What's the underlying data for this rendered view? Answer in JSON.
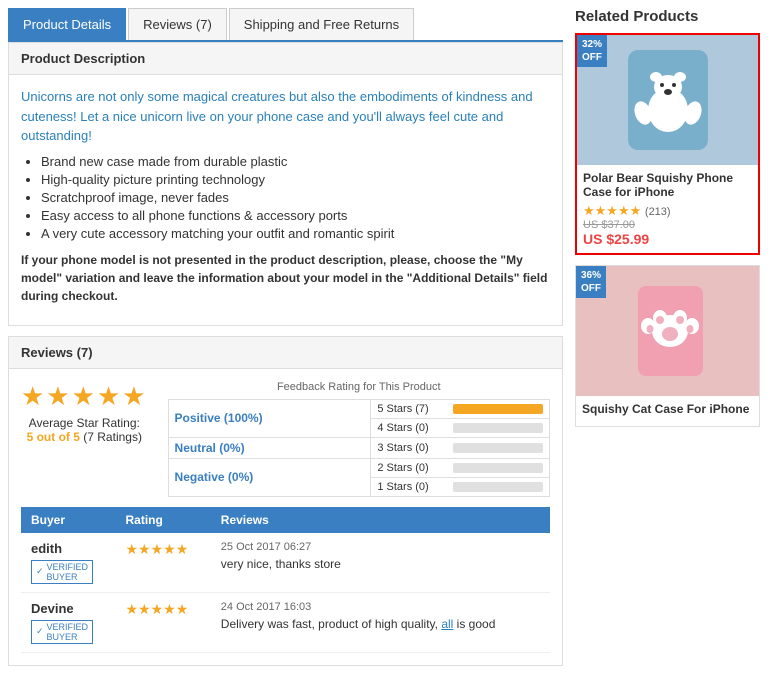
{
  "tabs": [
    {
      "label": "Product Details",
      "active": true
    },
    {
      "label": "Reviews (7)",
      "active": false
    },
    {
      "label": "Shipping and Free Returns",
      "active": false
    }
  ],
  "product_description": {
    "header": "Product Description",
    "intro": "Unicorns are not only some magical creatures but also the embodiments of kindness and cuteness! Let a nice unicorn live on your phone case and you'll always feel cute and outstanding!",
    "bullets": [
      "Brand new case made from durable plastic",
      "High-quality picture printing technology",
      "Scratchproof image, never fades",
      "Easy access to all phone functions & accessory ports",
      "A very cute accessory matching your outfit and romantic spirit"
    ],
    "notice": "If your phone model is not presented in the product description, please, choose the \"My model\" variation and leave the information about your model in the \"Additional Details\" field during checkout."
  },
  "reviews": {
    "header": "Reviews (7)",
    "avg_stars": "★★★★★",
    "avg_text": "Average Star Rating:",
    "avg_score": "5 out of 5",
    "avg_count": "(7 Ratings)",
    "feedback_title": "Feedback Rating for This Product",
    "feedback_rows": [
      {
        "label": "Positive (100%)",
        "stars": [
          {
            "label": "5 Stars (7)",
            "pct": 100
          },
          {
            "label": "4 Stars (0)",
            "pct": 0
          }
        ]
      },
      {
        "label": "Neutral (0%)",
        "stars": [
          {
            "label": "3 Stars (0)",
            "pct": 0
          }
        ]
      },
      {
        "label": "Negative (0%)",
        "stars": [
          {
            "label": "2 Stars (0)",
            "pct": 0
          },
          {
            "label": "1 Stars (0)",
            "pct": 0
          }
        ]
      }
    ],
    "bars": [
      {
        "label": "5 Stars (7)",
        "pct": 100
      },
      {
        "label": "4 Stars (0)",
        "pct": 0
      },
      {
        "label": "3 Stars (0)",
        "pct": 0
      },
      {
        "label": "2 Stars (0)",
        "pct": 0
      },
      {
        "label": "1 Stars (0)",
        "pct": 0
      }
    ],
    "table_headers": [
      "Buyer",
      "Rating",
      "Reviews"
    ],
    "entries": [
      {
        "buyer": "edith",
        "date": "25 Oct 2017 06:27",
        "stars": "★★★★★",
        "text": "very nice, thanks store",
        "verified": true
      },
      {
        "buyer": "Devine",
        "date": "24 Oct 2017 16:03",
        "stars": "★★★★★",
        "text": "Delivery was fast, product of high quality, all is good",
        "link_word": "all",
        "verified": true
      }
    ]
  },
  "sidebar": {
    "title": "Related Products",
    "products": [
      {
        "name": "Polar Bear Squishy Phone Case for iPhone",
        "discount": "32%\nOFF",
        "stars": "★★★★★",
        "review_count": "(213)",
        "price_old": "US $37.00",
        "price_new": "US $25.99",
        "highlighted": true,
        "img_type": "bear"
      },
      {
        "name": "Squishy Cat Case For iPhone",
        "discount": "36%\nOFF",
        "stars": "",
        "review_count": "",
        "price_old": "",
        "price_new": "",
        "highlighted": false,
        "img_type": "cat"
      }
    ]
  }
}
